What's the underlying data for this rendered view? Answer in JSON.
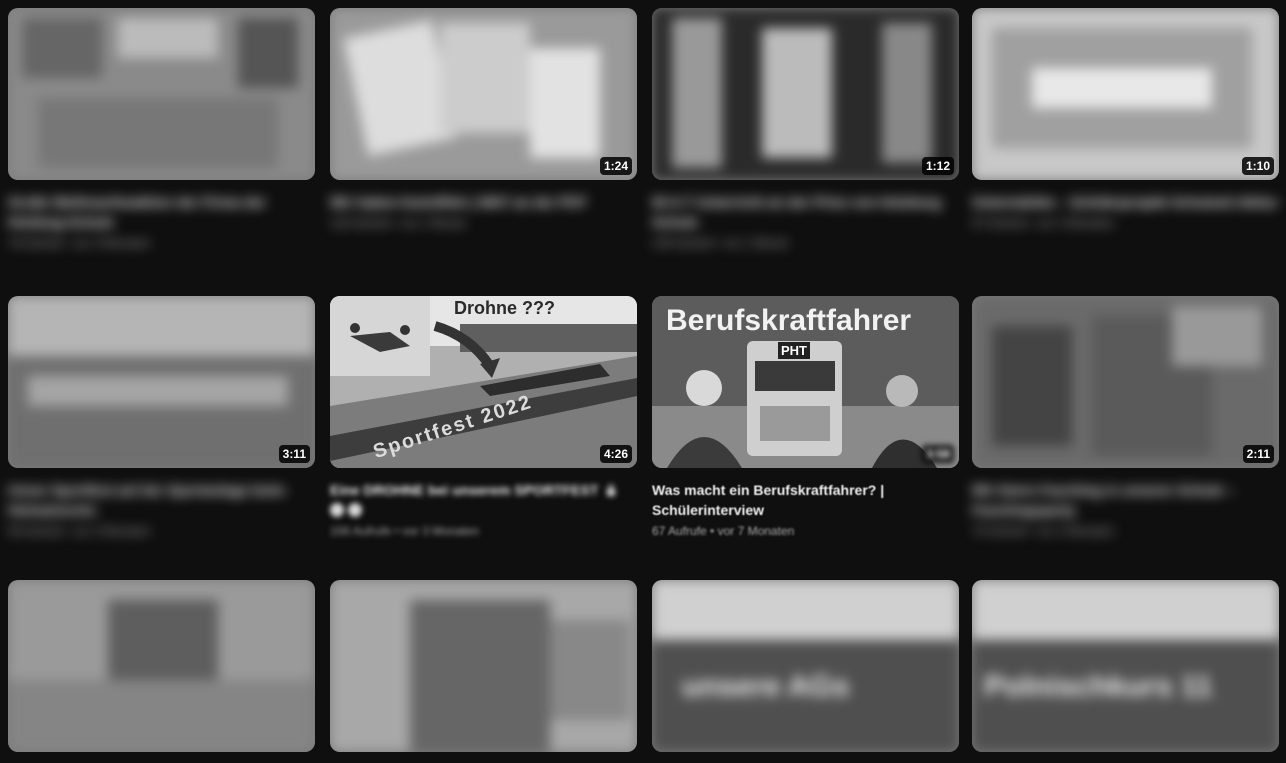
{
  "videos": [
    {
      "title": "Große Weihnachtsaktion der Firma der Holzbug-Schule",
      "stats": "78 Aufrufe • vor 3 Monaten",
      "duration": ""
    },
    {
      "title": "Wir haben Kartoffeln | WAT an der PHT",
      "stats": "118 Aufrufe • vor 1 Monat",
      "duration": "1:24"
    },
    {
      "title": "W-A-T Unterricht an der Prinz von Holzburg Schule",
      "stats": "149 Aufrufe • vor 1 Monat",
      "duration": "1:12"
    },
    {
      "title": "Ostermärkte – Schülerprojekt Schulzeit Abitur",
      "stats": "97 Aufrufe • vor 2 Monaten",
      "duration": "1:10"
    },
    {
      "title": "Unser Sportfest auf der Sportanlage beim Heimatverein",
      "stats": "58 Aufrufe • vor 3 Monaten",
      "duration": "3:11"
    },
    {
      "title": "Eine DROHNE bei unserem SPORTFEST",
      "stats": "156 Aufrufe • vor 3 Monaten",
      "duration": "4:26",
      "thumb_heading": "Drohne ???",
      "thumb_caption": "Sportfest 2022"
    },
    {
      "title": "Was macht ein Berufskraftfahrer? | Schülerinterview",
      "stats": "67 Aufrufe • vor 7 Monaten",
      "duration": "3:58",
      "thumb_heading": "Berufskraftfahrer",
      "thumb_truck_label": "PHT"
    },
    {
      "title": "Wir feiern Fasching in unserer Schule – Faschingsparty",
      "stats": "70 Aufrufe • vor 4 Monaten",
      "duration": "2:11"
    },
    {
      "title": "",
      "stats": "",
      "duration": ""
    },
    {
      "title": "",
      "stats": "",
      "duration": ""
    },
    {
      "title": "",
      "stats": "",
      "duration": "",
      "thumb_text": "unsere AGs"
    },
    {
      "title": "",
      "stats": "",
      "duration": "",
      "thumb_text": "Polnischkurs 11"
    }
  ]
}
